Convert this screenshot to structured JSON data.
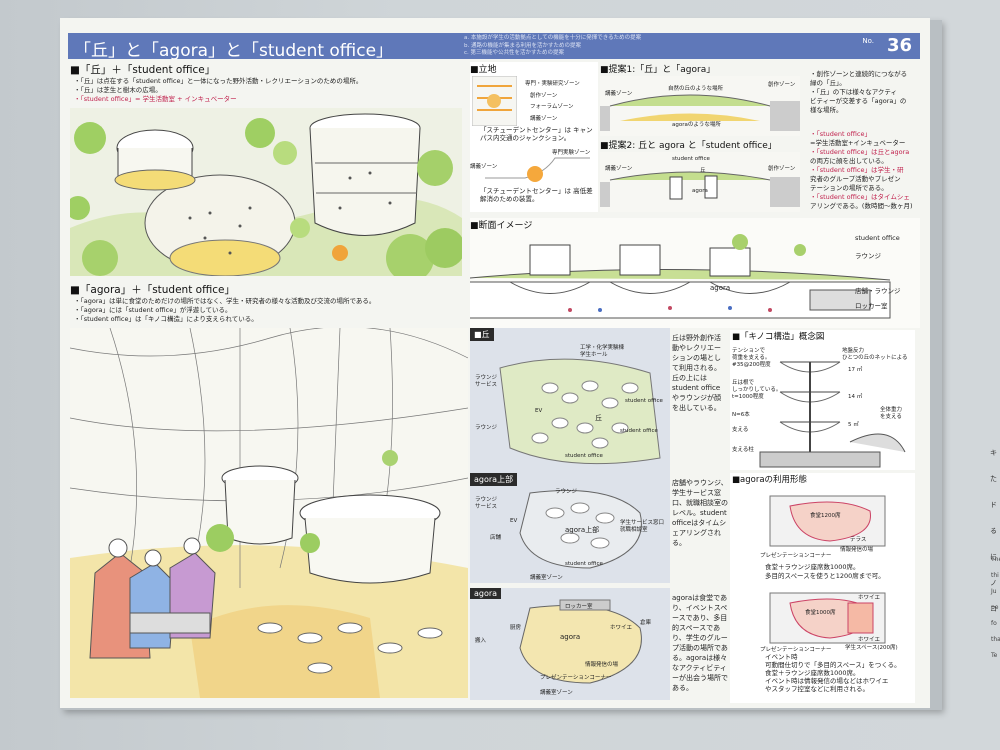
{
  "header": {
    "title": "「丘」と「agora」と「student office」",
    "notes": [
      "a. 本施設が学生の活動拠点としての機能を十分に発揮できるための提案",
      "b. 通路の機能が集まる利用を活かすための提案",
      "c. 第三機能や公共性を活かすための提案"
    ],
    "no_label": "No.",
    "number": "36"
  },
  "s1": {
    "heading": "■「丘」＋「student office」",
    "lines": [
      "・「丘」は点在する「student office」と一体になった野外活動・レクリエーションのための場所。",
      "・「丘」は芝生と樹木の広場。",
      "・「student office」= 学生活動室 + インキュベーター"
    ]
  },
  "s2": {
    "heading": "■「agora」＋「student office」",
    "lines": [
      "・「agora」は単に食堂のためだけの場所ではなく、学生・研究者の様々な活動及び交流の場所である。",
      "・「agora」には「student office」が浮遊している。",
      "・「student office」は「キノコ構造」により支えられている。"
    ]
  },
  "ritchi": {
    "heading": "■立地",
    "zones": [
      "専門・実験研究ゾーン",
      "創作ゾーン",
      "フォーラムゾーン",
      "講義ゾーン"
    ],
    "caption1": "「スチューデントセンター」は キャンパス内交通のジャンクション。",
    "zone_a": "講義ゾーン",
    "zone_b": "専門実験ゾーン",
    "caption2": "「スチューデントセンター」は 高低差解消のための装置。"
  },
  "p1": {
    "heading": "■提案1:「丘」と「agora」",
    "labels": [
      "講義ゾーン",
      "自然の丘のような場所",
      "創作ゾーン",
      "agoraのような場所"
    ],
    "text": [
      "・創作ゾーンと連続的につながる",
      "緑の「丘」。",
      "・「丘」の下は様々なアクティ",
      "ビティーが交差する「agora」の",
      "様な場所。"
    ]
  },
  "p2": {
    "heading": "■提案2: 丘と agora と「student office」",
    "labels": [
      "student office",
      "講義ゾーン",
      "丘",
      "agora",
      "創作ゾーン"
    ],
    "text": [
      "・「student office」",
      " =学生活動室+インキュベーター",
      "・「student office」は丘とagora",
      "の両方に顔を出している。",
      "・「student office」は学生・研",
      "究者のグループ活動やプレゼン",
      "テーションの場所である。",
      "・「student office」はタイムシェ",
      "アリングである。(数時間〜数ヶ月)"
    ]
  },
  "section": {
    "heading": "■断面イメージ",
    "labels": [
      "student office",
      "ラウンジ",
      "agora",
      "店舗・ラウンジ",
      "ロッカー室"
    ]
  },
  "oka": {
    "tag": "■丘",
    "labels": [
      "工学・化学実験棟",
      "学生ホール",
      "ラウンジ",
      "サービス",
      "EV",
      "丘",
      "ラウンジ",
      "student office",
      "student office",
      "student office"
    ],
    "desc": "丘は野外創作活動やレクリエーションの場として利用される。丘の上には student officeやラウンジが顔を出している。"
  },
  "kinoko": {
    "heading": "■「キノコ構造」概念図",
    "labels": [
      "テンションで",
      "荷重を支える。",
      "#35@200程度",
      "丘は根で",
      "しっかりしている。",
      "t=1000程度",
      "N=6本",
      "支える",
      "地盤反力",
      "ひとつの丘のネットによる",
      "支える柱",
      "17 ㎡",
      "14 ㎡",
      "5 ㎡",
      "全体重力",
      "を支える"
    ]
  },
  "agora_upper": {
    "tag": "agora上部",
    "labels": [
      "ラウンジ",
      "ラウンジ",
      "サービス",
      "EV",
      "店舗",
      "agora上部",
      "学生サービス窓口",
      "就職相談室",
      "student office",
      "講義室ゾーン"
    ],
    "desc": "店舗やラウンジ、学生サービス窓口、就職相談室のレベル。student officeはタイムシェアリングされる。"
  },
  "usage": {
    "heading": "■agoraの利用形態",
    "labels1": [
      "食堂1200席",
      "テラス",
      "プレゼンテーションコーナー",
      "情報発信の場"
    ],
    "caption1": "食堂＋ラウンジ座席数1000席。\n多目的スペースを使うと1200席まで可。",
    "labels2": [
      "ホワイエ",
      "食堂1000席",
      "プレゼンテーションコーナー",
      "ホワイエ",
      "学生スペース(200席)"
    ],
    "caption2": "イベント時\n可動間仕切りで「多目的スペース」をつくる。\n食堂＋ラウンジ座席数1000席。\nイベント時は情報発信の場などはホワイエ\nやスタッフ控室などに利用される。"
  },
  "agora_plan": {
    "tag": "agora",
    "labels": [
      "ロッカー室",
      "厨房",
      "搬入",
      "agora",
      "ホワイエ",
      "倉庫",
      "情報発信の場",
      "プレゼンテーションコーナー",
      "講義室ゾーン"
    ],
    "desc": "agoraは食堂であり、イベントスペースであり、多目的スペースであり、学生のグループ活動の場所である。agoraは様々なアクティビティーが出会う場所である。"
  },
  "side_text": [
    "キ",
    "た",
    "ド",
    "る",
    "に",
    "ノコ",
    "The",
    "thi",
    "Ju",
    "pe",
    "fo",
    "tha",
    "Te"
  ],
  "colors": {
    "banner": "#5f78b9",
    "accent": "#c0214d",
    "green": "#a9cf6b",
    "yellow": "#f2dc7a"
  }
}
